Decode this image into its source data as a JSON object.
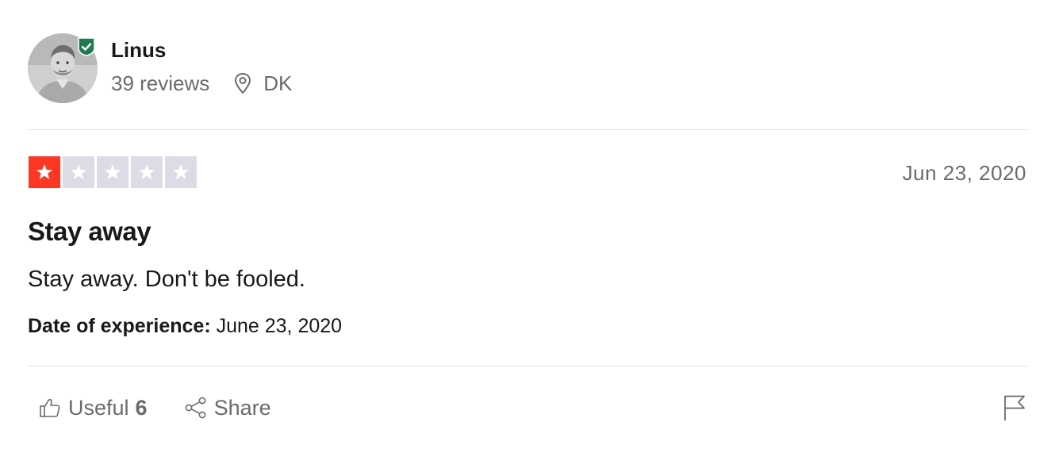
{
  "reviewer": {
    "name": "Linus",
    "reviews_count": "39 reviews",
    "country": "DK",
    "verified": true
  },
  "review": {
    "rating": 1,
    "max_rating": 5,
    "date": "Jun 23, 2020",
    "title": "Stay away",
    "body": "Stay away. Don't be fooled.",
    "experience_label": "Date of experience:",
    "experience_date": "June 23, 2020"
  },
  "actions": {
    "useful_label": "Useful",
    "useful_count": "6",
    "share_label": "Share"
  },
  "icons": {
    "verified": "shield-check-icon",
    "location": "map-pin-icon",
    "thumbs_up": "thumbs-up-icon",
    "share": "share-icon",
    "flag": "flag-icon",
    "star": "star-icon"
  },
  "colors": {
    "star_active": "#ff3722",
    "star_inactive": "#dcdce6",
    "verified": "#04da8d",
    "verified_dark": "#1f7a4f",
    "muted_text": "#6b6b6b",
    "divider": "#dcdce6"
  }
}
